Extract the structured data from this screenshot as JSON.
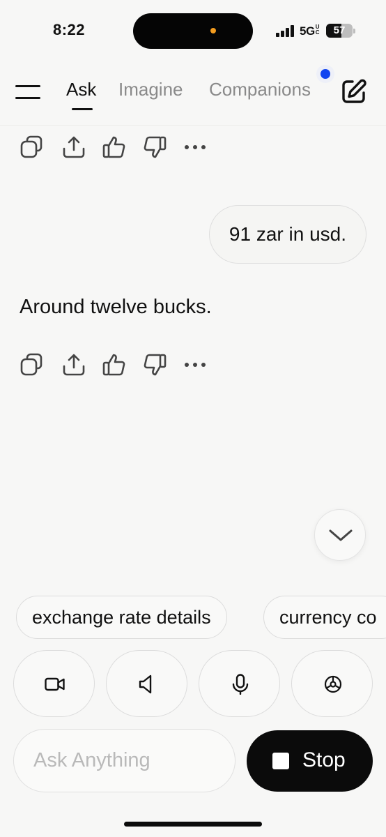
{
  "status_bar": {
    "time": "8:22",
    "network": "5G",
    "network_suffix": "UC",
    "battery": "57",
    "battery_level": 0.57
  },
  "nav": {
    "tabs": [
      {
        "label": "Ask",
        "active": true
      },
      {
        "label": "Imagine",
        "active": false
      },
      {
        "label": "Companions",
        "active": false
      }
    ],
    "icons": [
      "menu-icon",
      "edit-icon"
    ]
  },
  "message_actions": [
    "copy-icon",
    "share-icon",
    "thumbs-up-icon",
    "thumbs-down-icon",
    "more-icon"
  ],
  "chat": {
    "user_message": "91 zar in usd.",
    "assistant_message": "Around twelve bucks."
  },
  "suggestions": [
    "exchange rate details",
    "currency co"
  ],
  "modes": [
    "video-icon",
    "speaker-icon",
    "microphone-icon",
    "settings-icon"
  ],
  "composer": {
    "placeholder": "Ask Anything",
    "value": "",
    "stop_label": "Stop"
  },
  "colors": {
    "background": "#f7f7f6",
    "notification_dot": "#1346f0",
    "island_indicator": "#f39c1f"
  }
}
